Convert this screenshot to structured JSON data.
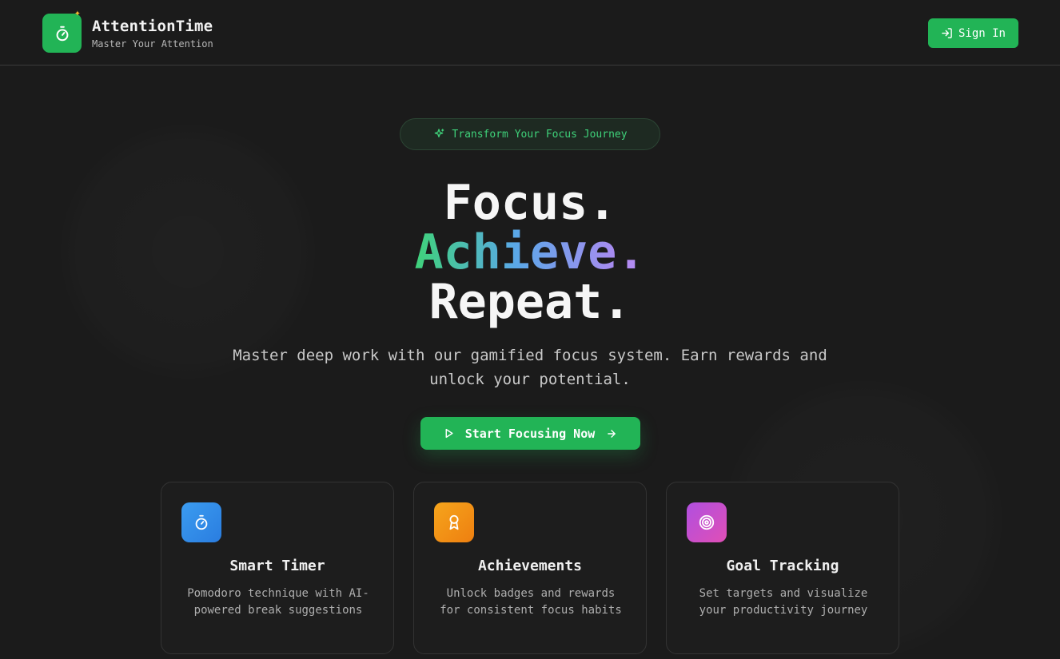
{
  "header": {
    "brand_title": "AttentionTime",
    "brand_subtitle": "Master Your Attention",
    "logo_icon": "stopwatch-icon",
    "sparkle_icon": "sparkle-icon",
    "signin_label": "Sign In",
    "signin_icon": "sign-in-icon"
  },
  "badge": {
    "label": "Transform Your Focus Journey",
    "icon": "sparkles-icon"
  },
  "hero": {
    "line1": "Focus.",
    "line2_word": "Achieve",
    "line2_dot": ".",
    "line3": "Repeat.",
    "subtitle": "Master deep work with our gamified focus system. Earn rewards and unlock your potential."
  },
  "cta": {
    "label": "Start Focusing Now",
    "icon_left": "play-icon",
    "icon_right": "arrow-right-icon"
  },
  "features": [
    {
      "title": "Smart Timer",
      "description": "Pomodoro technique with AI-powered break suggestions",
      "icon": "timer-icon"
    },
    {
      "title": "Achievements",
      "description": "Unlock badges and rewards for consistent focus habits",
      "icon": "award-icon"
    },
    {
      "title": "Goal Tracking",
      "description": "Set targets and visualize your productivity journey",
      "icon": "target-icon"
    }
  ],
  "colors": {
    "background": "#1b1b1b",
    "accent_green": "#22b456",
    "gradient_green": "#3fd27a",
    "gradient_blue": "#5aa8e8",
    "gradient_purple": "#a98bf0",
    "icon_blue": "#3b9cf0",
    "icon_orange": "#f6a51c",
    "icon_purple": "#b04fe0"
  }
}
